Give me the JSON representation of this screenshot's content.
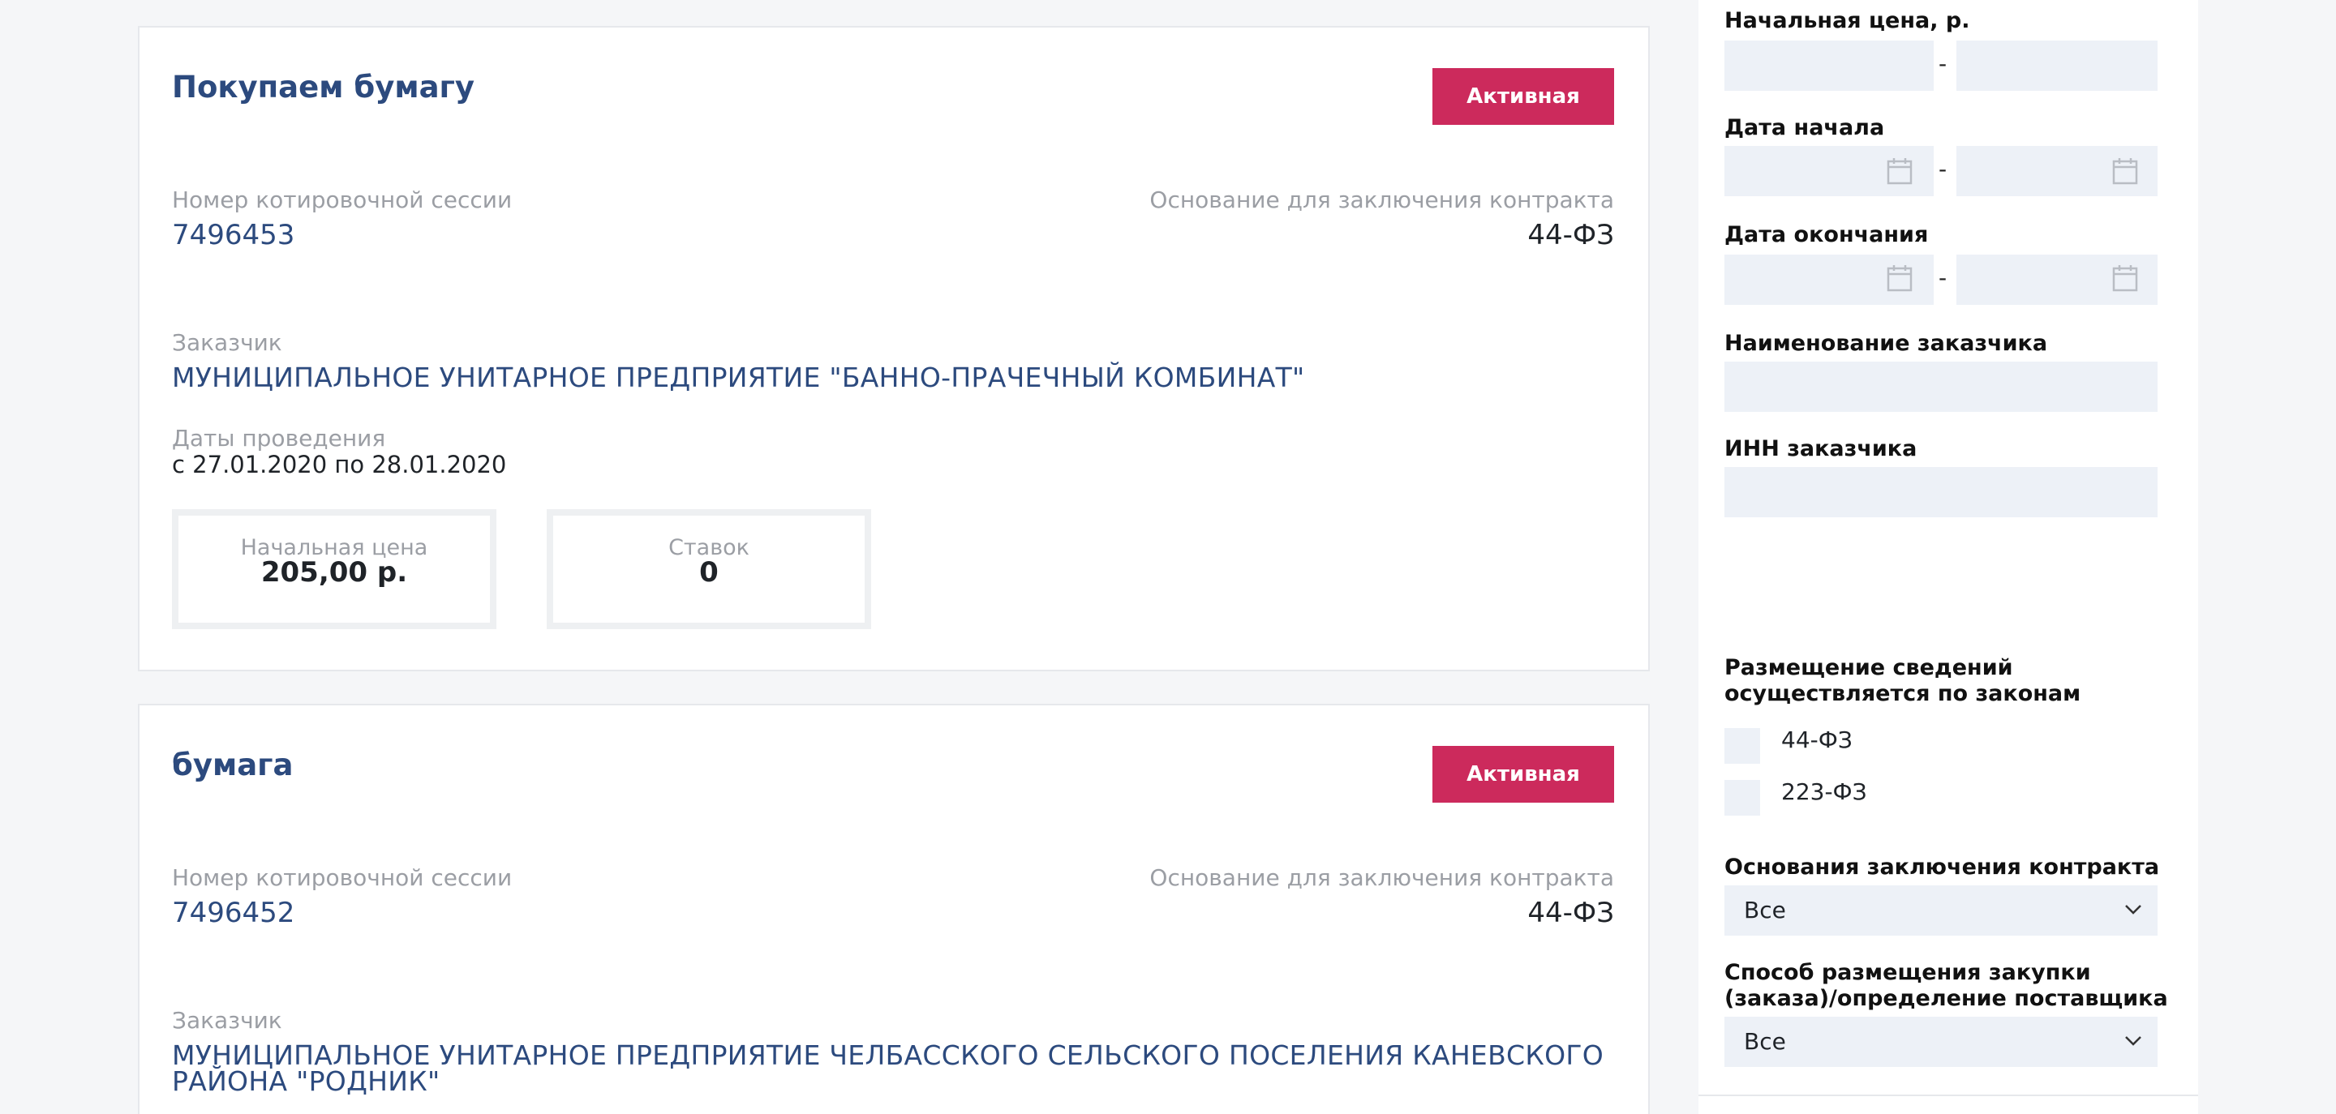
{
  "cards": [
    {
      "title": "Покупаем бумагу",
      "status": "Активная",
      "session_label": "Номер котировочной сессии",
      "session_number": "7496453",
      "basis_label": "Основание для заключения контракта",
      "basis_value": "44-ФЗ",
      "customer_label": "Заказчик",
      "customer_name": "МУНИЦИПАЛЬНОЕ УНИТАРНОЕ ПРЕДПРИЯТИЕ \"БАННО-ПРАЧЕЧНЫЙ КОМБИНАТ\"",
      "dates_label": "Даты проведения",
      "dates_value": "с 27.01.2020 по 28.01.2020",
      "price_label": "Начальная цена",
      "price_value": "205,00 р.",
      "bids_label": "Ставок",
      "bids_value": "0"
    },
    {
      "title": "бумага",
      "status": "Активная",
      "session_label": "Номер котировочной сессии",
      "session_number": "7496452",
      "basis_label": "Основание для заключения контракта",
      "basis_value": "44-ФЗ",
      "customer_label": "Заказчик",
      "customer_name": "МУНИЦИПАЛЬНОЕ УНИТАРНОЕ ПРЕДПРИЯТИЕ ЧЕЛБАССКОГО СЕЛЬСКОГО ПОСЕЛЕНИЯ КАНЕВСКОГО РАЙОНА \"РОДНИК\""
    }
  ],
  "filters": {
    "price_label": "Начальная цена, р.",
    "start_date_label": "Дата начала",
    "end_date_label": "Дата окончания",
    "customer_name_label": "Наименование заказчика",
    "customer_inn_label": "ИНН заказчика",
    "range_separator": "-",
    "laws_label": "Размещение сведений осуществляется по законам",
    "laws_options": [
      "44-ФЗ",
      "223-ФЗ"
    ],
    "contract_basis_label": "Основания заключения контракта",
    "contract_basis_value": "Все",
    "procurement_method_label": "Способ размещения закупки (заказа)/определение поставщика",
    "procurement_method_value": "Все"
  },
  "colors": {
    "accent": "#cc2a5c",
    "link": "#2c4a7e",
    "input_bg": "#edf1f7",
    "muted": "#9b9ea4"
  }
}
